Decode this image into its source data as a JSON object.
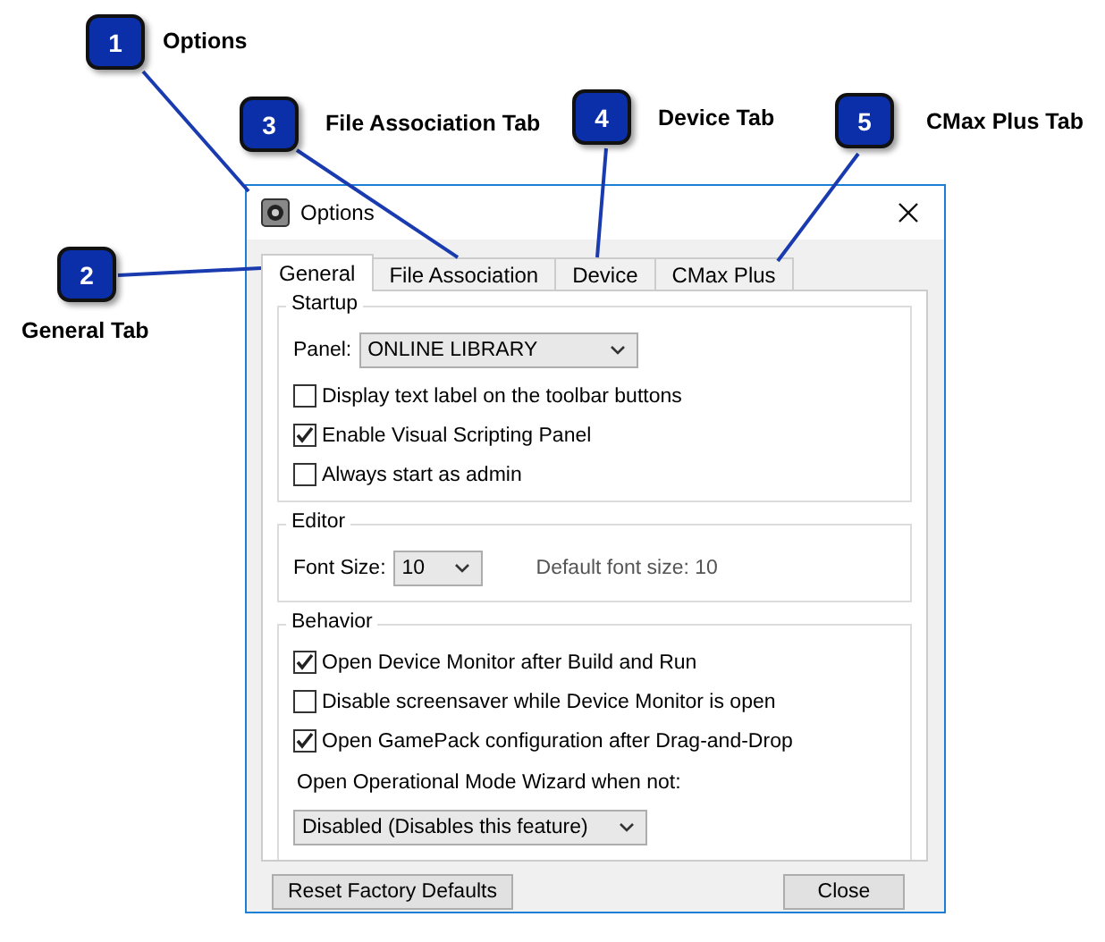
{
  "callouts": [
    {
      "number": "1",
      "label": "Options"
    },
    {
      "number": "2",
      "label": "General Tab"
    },
    {
      "number": "3",
      "label": "File Association Tab"
    },
    {
      "number": "4",
      "label": "Device Tab"
    },
    {
      "number": "5",
      "label": "CMax Plus Tab"
    }
  ],
  "dialog": {
    "title": "Options",
    "tabs": [
      {
        "label": "General",
        "selected": true
      },
      {
        "label": "File Association",
        "selected": false
      },
      {
        "label": "Device",
        "selected": false
      },
      {
        "label": "CMax Plus",
        "selected": false
      }
    ],
    "groups": [
      {
        "title": "Startup",
        "items": [
          {
            "kind": "select",
            "label": "Panel:",
            "value": "ONLINE LIBRARY"
          },
          {
            "kind": "checkbox",
            "label": "Display text label on the toolbar buttons",
            "checked": false
          },
          {
            "kind": "checkbox",
            "label": "Enable Visual Scripting Panel",
            "checked": true
          },
          {
            "kind": "checkbox",
            "label": "Always start as admin",
            "checked": false
          }
        ]
      },
      {
        "title": "Editor",
        "items": [
          {
            "kind": "select",
            "label": "Font Size:",
            "value": "10",
            "note": "Default font size: 10"
          }
        ]
      },
      {
        "title": "Behavior",
        "items": [
          {
            "kind": "checkbox",
            "label": "Open Device Monitor after Build and Run",
            "checked": true
          },
          {
            "kind": "checkbox",
            "label": "Disable screensaver while Device Monitor is open",
            "checked": false
          },
          {
            "kind": "checkbox",
            "label": "Open GamePack configuration after Drag-and-Drop",
            "checked": true
          },
          {
            "kind": "text",
            "label": "Open Operational Mode Wizard when not:"
          },
          {
            "kind": "select",
            "value": "Disabled (Disables this feature)"
          }
        ]
      }
    ],
    "buttons": [
      "Reset Factory Defaults",
      "Close"
    ]
  }
}
